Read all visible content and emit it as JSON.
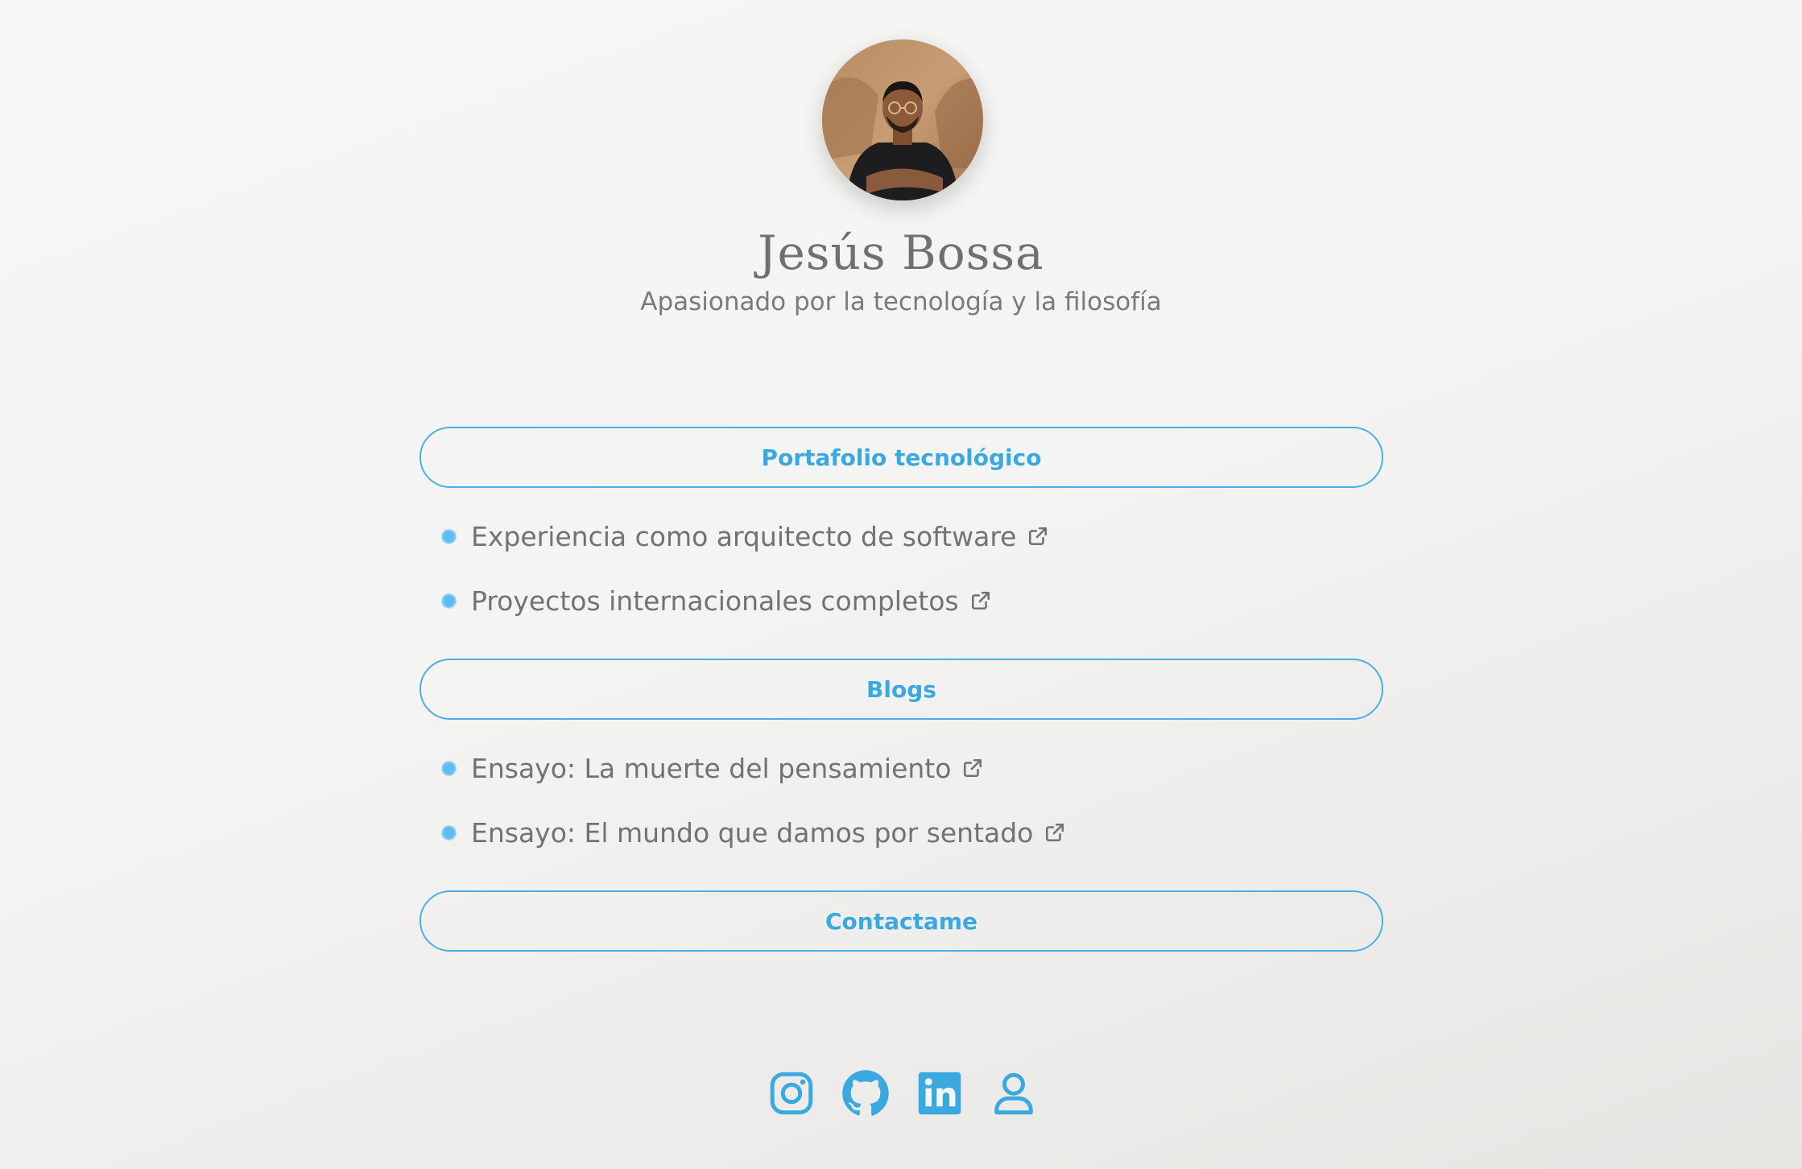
{
  "profile": {
    "name": "Jesús Bossa",
    "tagline": "Apasionado por la tecnología y la filosofía"
  },
  "sections": [
    {
      "label": "Portafolio tecnológico",
      "items": [
        {
          "label": "Experiencia como arquitecto de software",
          "icon": "external-link-icon"
        },
        {
          "label": "Proyectos internacionales completos",
          "icon": "external-link-icon"
        }
      ]
    },
    {
      "label": "Blogs",
      "items": [
        {
          "label": "Ensayo: La muerte del pensamiento",
          "icon": "external-link-icon"
        },
        {
          "label": "Ensayo: El mundo que damos por sentado",
          "icon": "external-link-icon"
        }
      ]
    },
    {
      "label": "Contactame",
      "items": []
    }
  ],
  "social": [
    {
      "icon": "instagram-icon"
    },
    {
      "icon": "github-icon"
    },
    {
      "icon": "linkedin-icon"
    },
    {
      "icon": "user-profile-icon"
    }
  ],
  "colors": {
    "accent": "#3aa9e0",
    "text": "#727272",
    "background": "#f4f4f3"
  }
}
